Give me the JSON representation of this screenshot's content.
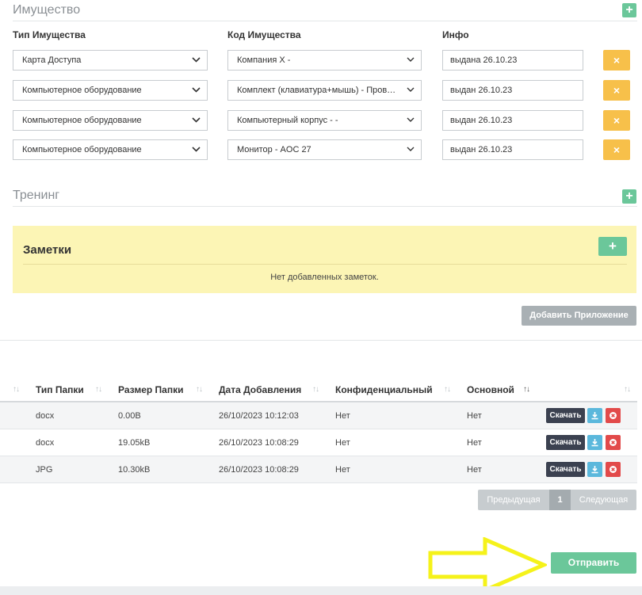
{
  "property": {
    "title": "Имущество",
    "add_label": "+",
    "col_type": "Тип Имущества",
    "col_code": "Код Имущества",
    "col_info": "Инфо",
    "remove_label": "×",
    "rows": [
      {
        "type": "Карта Доступа",
        "code": "Компания X -",
        "info": "выдана 26.10.23"
      },
      {
        "type": "Компьютерное оборудование",
        "code": "Комплект (клавиатура+мышь) - Проводной -",
        "info": "выдан 26.10.23"
      },
      {
        "type": "Компьютерное оборудование",
        "code": "Компьютерный корпус - -",
        "info": "выдан 26.10.23"
      },
      {
        "type": "Компьютерное оборудование",
        "code": "Монитор - AOC 27",
        "info": "выдан 26.10.23"
      }
    ]
  },
  "training": {
    "title": "Тренинг",
    "add_label": "+"
  },
  "notes": {
    "title": "Заметки",
    "add_label": "+",
    "empty_text": "Нет добавленных заметок."
  },
  "attachments": {
    "add_button": "Добавить Приложение",
    "headers": [
      "Тип Папки",
      "Размер Папки",
      "Дата Добавления",
      "Конфиденциальный",
      "Основной"
    ],
    "rows": [
      {
        "type": "docx",
        "size": "0.00B",
        "date": "26/10/2023 10:12:03",
        "confidential": "Нет",
        "main": "Нет"
      },
      {
        "type": "docx",
        "size": "19.05kB",
        "date": "26/10/2023 10:08:29",
        "confidential": "Нет",
        "main": "Нет"
      },
      {
        "type": "JPG",
        "size": "10.30kB",
        "date": "26/10/2023 10:08:29",
        "confidential": "Нет",
        "main": "Нет"
      }
    ],
    "download_label": "Скачать"
  },
  "pagination": {
    "prev": "Предыдущая",
    "page": "1",
    "next": "Следующая"
  },
  "submit_label": "Отправить",
  "colors": {
    "green": "#6bc79a",
    "yellow_btn": "#f7c04a",
    "notes_bg": "#fcf5b5",
    "arrow": "#f5f21a"
  }
}
